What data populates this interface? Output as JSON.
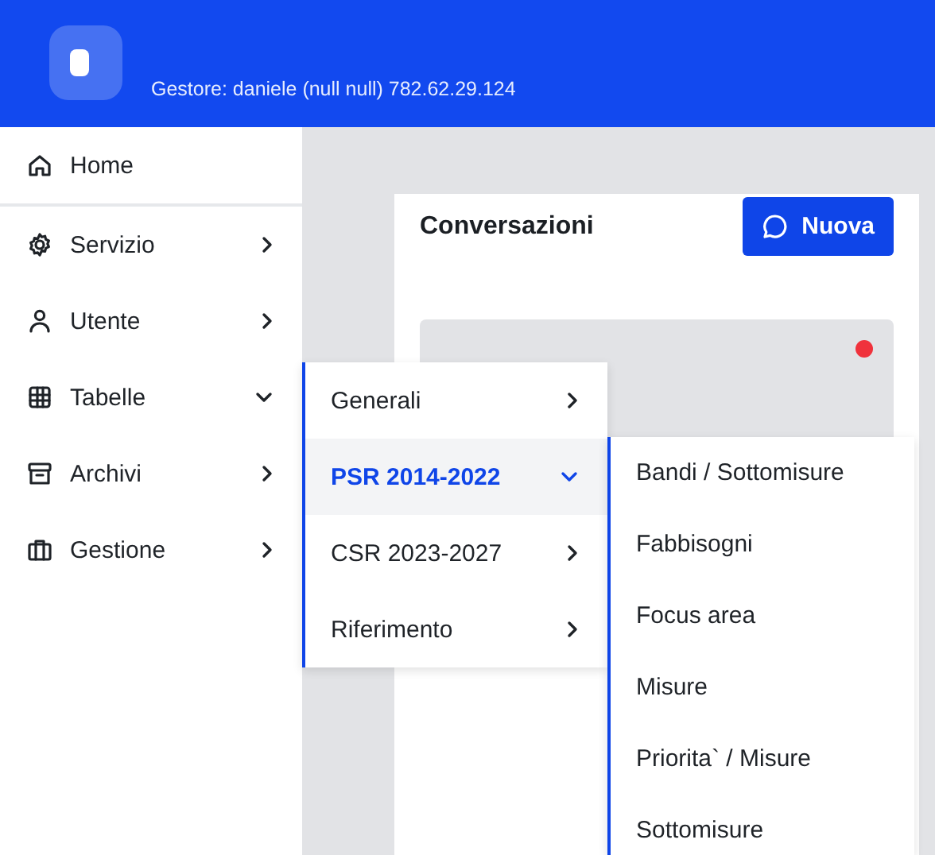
{
  "header": {
    "manager": "Gestore: daniele (null null) 782.62.29.124"
  },
  "sidebar": {
    "items": [
      {
        "label": "Home",
        "kind": "link"
      },
      {
        "label": "Servizio",
        "kind": "group",
        "expanded": false
      },
      {
        "label": "Utente",
        "kind": "group",
        "expanded": false
      },
      {
        "label": "Tabelle",
        "kind": "group",
        "expanded": true
      },
      {
        "label": "Archivi",
        "kind": "group",
        "expanded": false
      },
      {
        "label": "Gestione",
        "kind": "group",
        "expanded": false
      }
    ]
  },
  "submenu": {
    "items": [
      {
        "label": "Generali",
        "selected": false,
        "expanded": false
      },
      {
        "label": "PSR 2014-2022",
        "selected": true,
        "expanded": true
      },
      {
        "label": "CSR 2023-2027",
        "selected": false,
        "expanded": false
      },
      {
        "label": "Riferimento",
        "selected": false,
        "expanded": false
      }
    ]
  },
  "sub_submenu": {
    "items": [
      {
        "label": "Bandi / Sottomisure"
      },
      {
        "label": "Fabbisogni"
      },
      {
        "label": "Focus area"
      },
      {
        "label": "Misure"
      },
      {
        "label": "Priorita` / Misure"
      },
      {
        "label": "Sottomisure"
      }
    ]
  },
  "conversations": {
    "title": "Conversazioni",
    "new_button": "Nuova",
    "items": [
      {
        "unread": true
      }
    ]
  }
}
